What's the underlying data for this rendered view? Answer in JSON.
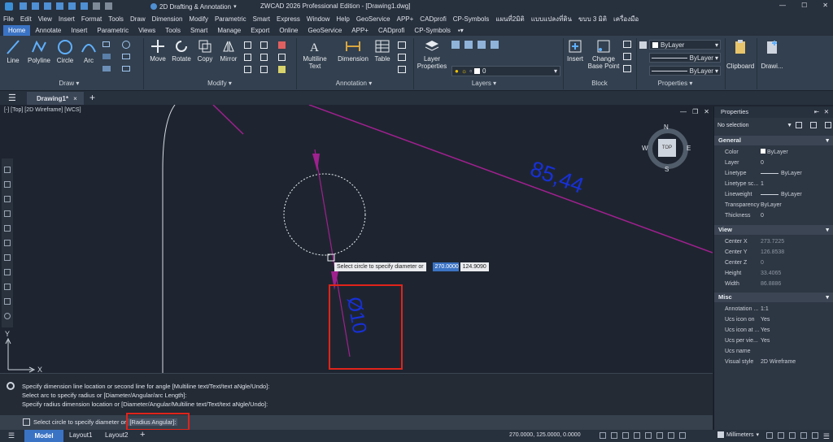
{
  "title": {
    "workspace": "2D Drafting & Annotation",
    "app": "ZWCAD 2026 Professional Edition - [Drawing1.dwg]"
  },
  "menu": [
    "File",
    "Edit",
    "View",
    "Insert",
    "Format",
    "Tools",
    "Draw",
    "Dimension",
    "Modify",
    "Parametric",
    "Smart",
    "Express",
    "Window",
    "Help",
    "GeoService",
    "APP+",
    "CADprofi",
    "CP-Symbols",
    "แผนที่2มิติ",
    "แบบแปลงที่ดิน",
    "ขบบ 3 มิติ",
    "เครื่องมือ"
  ],
  "ribbon_tabs": [
    "Home",
    "Annotate",
    "Insert",
    "Parametric",
    "Views",
    "Tools",
    "Smart",
    "Manage",
    "Export",
    "Online",
    "GeoService",
    "APP+",
    "CADprofi",
    "CP-Symbols"
  ],
  "ribbon": {
    "line": "Line",
    "polyline": "Polyline",
    "circle": "Circle",
    "arc": "Arc",
    "move": "Move",
    "rotate": "Rotate",
    "copy": "Copy",
    "mirror": "Mirror",
    "mtext_1": "Multiline",
    "mtext_2": "Text",
    "dimension": "Dimension",
    "table": "Table",
    "layer_1": "Layer",
    "layer_2": "Properties",
    "layer_value": "0",
    "insert": "Insert",
    "change_1": "Change",
    "change_2": "Base Point",
    "bylayer": "ByLayer",
    "clipboard": "Clipboard",
    "draw_more": "Drawi...",
    "groups": {
      "draw": "Draw",
      "modify": "Modify",
      "annotation": "Annotation",
      "layers": "Layers",
      "block": "Block",
      "properties": "Properties"
    }
  },
  "doc_tab": "Drawing1*",
  "viewport_label": "[-] [Top] [2D Wireframe] [WCS]",
  "viewcube": {
    "n": "N",
    "s": "S",
    "e": "E",
    "w": "W",
    "top": "TOP"
  },
  "drawing": {
    "dim_linear": "85,44",
    "dim_diameter": "Ø10"
  },
  "tooltip": {
    "prompt": "Select circle to specify diameter or",
    "x": "270.0000",
    "y": "124.9090"
  },
  "ucs": {
    "x": "X",
    "y": "Y"
  },
  "properties": {
    "title": "Properties",
    "selection": "No selection",
    "sections": {
      "general": "General",
      "view": "View",
      "misc": "Misc"
    },
    "general": [
      [
        "Color",
        "ByLayer"
      ],
      [
        "Layer",
        "0"
      ],
      [
        "Linetype",
        "ByLayer"
      ],
      [
        "Linetype sc...",
        "1"
      ],
      [
        "Lineweight",
        "ByLayer"
      ],
      [
        "Transparency",
        "ByLayer"
      ],
      [
        "Thickness",
        "0"
      ]
    ],
    "view": [
      [
        "Center X",
        "273.7225"
      ],
      [
        "Center Y",
        "126.8538"
      ],
      [
        "Center Z",
        "0"
      ],
      [
        "Height",
        "33.4065"
      ],
      [
        "Width",
        "86.8886"
      ]
    ],
    "misc": [
      [
        "Annotation ...",
        "1:1"
      ],
      [
        "Ucs icon on",
        "Yes"
      ],
      [
        "Ucs icon at ...",
        "Yes"
      ],
      [
        "Ucs per vie...",
        "Yes"
      ],
      [
        "Ucs name",
        ""
      ],
      [
        "Visual style",
        "2D Wireframe"
      ]
    ]
  },
  "command_history": [
    "Specify dimension line location or second line for angle [Multiline text/Text/text aNgle/Undo]:",
    "Select arc to specify radius or [Diameter/Angular/arc Length]:",
    "Specify radius dimension location or [Diameter/Angular/Multiline text/Text/text aNgle/Undo]:"
  ],
  "command_input": {
    "prompt": "Select circle to specify diameter or",
    "options": "[Radius Angular]:"
  },
  "layout_tabs": [
    "Model",
    "Layout1",
    "Layout2"
  ],
  "status": {
    "coords": "270.0000, 125.0000, 0.0000",
    "units": "Millimeters"
  },
  "colors": {
    "accent": "#3b73c4",
    "dim_blue": "#1730d8",
    "magenta": "#a0208f",
    "highlight_red": "#e0241b"
  }
}
